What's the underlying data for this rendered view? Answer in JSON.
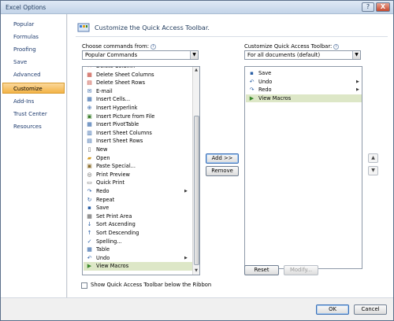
{
  "window": {
    "title": "Excel Options"
  },
  "titlebar": {
    "help_glyph": "?",
    "close_glyph": "X"
  },
  "sidebar": {
    "items": [
      {
        "label": "Popular"
      },
      {
        "label": "Formulas"
      },
      {
        "label": "Proofing"
      },
      {
        "label": "Save"
      },
      {
        "label": "Advanced"
      },
      {
        "label": "Customize"
      },
      {
        "label": "Add-Ins"
      },
      {
        "label": "Trust Center"
      },
      {
        "label": "Resources"
      }
    ],
    "selected": "Customize"
  },
  "header": {
    "title": "Customize the Quick Access Toolbar."
  },
  "choose": {
    "label": "Choose commands from:",
    "value": "Popular Commands",
    "list": [
      {
        "label": "Delete Column",
        "icon": "✕",
        "color": "#c0392b"
      },
      {
        "label": "Delete Sheet Columns",
        "icon": "▦",
        "color": "#c0392b"
      },
      {
        "label": "Delete Sheet Rows",
        "icon": "▤",
        "color": "#c0392b"
      },
      {
        "label": "E-mail",
        "icon": "✉",
        "color": "#2a5fa5"
      },
      {
        "label": "Insert Cells...",
        "icon": "▦",
        "color": "#2a5fa5"
      },
      {
        "label": "Insert Hyperlink",
        "icon": "⊕",
        "color": "#2a5fa5"
      },
      {
        "label": "Insert Picture from File",
        "icon": "▣",
        "color": "#3a7d2c"
      },
      {
        "label": "Insert PivotTable",
        "icon": "▦",
        "color": "#2a5fa5"
      },
      {
        "label": "Insert Sheet Columns",
        "icon": "▥",
        "color": "#2a5fa5"
      },
      {
        "label": "Insert Sheet Rows",
        "icon": "▤",
        "color": "#2a5fa5"
      },
      {
        "label": "New",
        "icon": "▯",
        "color": "#555555"
      },
      {
        "label": "Open",
        "icon": "▰",
        "color": "#d39a1f"
      },
      {
        "label": "Paste Special...",
        "icon": "▣",
        "color": "#8a6d2f"
      },
      {
        "label": "Print Preview",
        "icon": "◎",
        "color": "#555555"
      },
      {
        "label": "Quick Print",
        "icon": "▭",
        "color": "#555555"
      },
      {
        "label": "Redo",
        "icon": "↷",
        "color": "#2a5fa5",
        "submenu": "▶"
      },
      {
        "label": "Repeat",
        "icon": "↻",
        "color": "#2a5fa5"
      },
      {
        "label": "Save",
        "icon": "▪",
        "color": "#2a5fa5"
      },
      {
        "label": "Set Print Area",
        "icon": "▦",
        "color": "#555555"
      },
      {
        "label": "Sort Ascending",
        "icon": "↓",
        "color": "#2a5fa5"
      },
      {
        "label": "Sort Descending",
        "icon": "↑",
        "color": "#2a5fa5"
      },
      {
        "label": "Spelling...",
        "icon": "✓",
        "color": "#2a5fa5"
      },
      {
        "label": "Table",
        "icon": "▦",
        "color": "#2a5fa5"
      },
      {
        "label": "Undo",
        "icon": "↶",
        "color": "#2a5fa5",
        "submenu": "▶"
      },
      {
        "label": "View Macros",
        "icon": "▶",
        "color": "#3a8a2c"
      }
    ]
  },
  "customize": {
    "label": "Customize Quick Access Toolbar:",
    "value": "For all documents (default)",
    "list": [
      {
        "label": "Save",
        "icon": "▪",
        "color": "#2a5fa5"
      },
      {
        "label": "Undo",
        "icon": "↶",
        "color": "#2a5fa5",
        "submenu": "▶"
      },
      {
        "label": "Redo",
        "icon": "↷",
        "color": "#2a5fa5",
        "submenu": "▶"
      },
      {
        "label": "View Macros",
        "icon": "▶",
        "color": "#3a8a2c"
      }
    ]
  },
  "buttons": {
    "add": "Add >>",
    "remove": "Remove",
    "reset": "Reset",
    "modify": "Modify...",
    "ok": "OK",
    "cancel": "Cancel",
    "move_up": "▲",
    "move_down": "▼"
  },
  "checkbox": {
    "label": "Show Quick Access Toolbar below the Ribbon",
    "checked": false
  },
  "colors": {
    "selected_nav": "#f3b347",
    "selected_row": "#dde7c7",
    "accent": "#1e395b"
  }
}
